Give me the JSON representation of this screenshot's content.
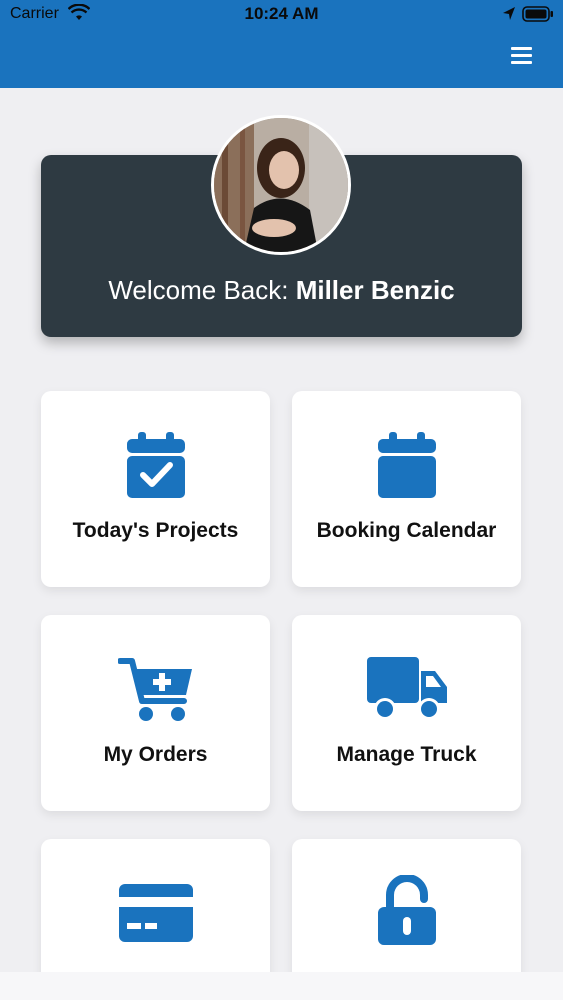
{
  "status_bar": {
    "carrier": "Carrier",
    "time": "10:24 AM"
  },
  "colors": {
    "brand": "#1a73be",
    "card_dark": "#2e3a42",
    "background": "#efeff2"
  },
  "welcome": {
    "prefix": "Welcome Back: ",
    "name": "Miller Benzic"
  },
  "tiles": [
    {
      "label": "Today's Projects",
      "icon": "calendar-check-icon"
    },
    {
      "label": "Booking Calendar",
      "icon": "calendar-icon"
    },
    {
      "label": "My Orders",
      "icon": "cart-plus-icon"
    },
    {
      "label": "Manage Truck",
      "icon": "truck-icon"
    },
    {
      "label": "",
      "icon": "credit-card-icon"
    },
    {
      "label": "",
      "icon": "unlock-icon"
    }
  ]
}
